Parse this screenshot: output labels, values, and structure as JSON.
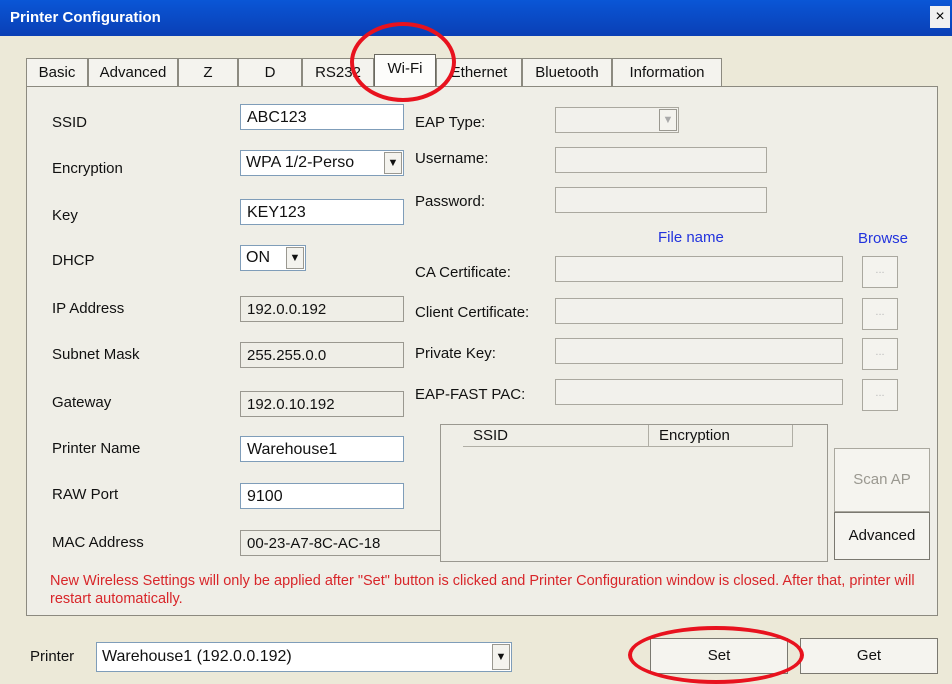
{
  "window": {
    "title": "Printer Configuration",
    "close_glyph": "×"
  },
  "tabs": [
    {
      "label": "Basic"
    },
    {
      "label": "Advanced"
    },
    {
      "label": "Z"
    },
    {
      "label": "D"
    },
    {
      "label": "RS232"
    },
    {
      "label": "Wi-Fi",
      "active": true
    },
    {
      "label": "Ethernet"
    },
    {
      "label": "Bluetooth"
    },
    {
      "label": "Information"
    }
  ],
  "form": {
    "ssid": {
      "label": "SSID",
      "value": "ABC123"
    },
    "encryption": {
      "label": "Encryption",
      "value": "WPA 1/2-Perso"
    },
    "key": {
      "label": "Key",
      "value": "KEY123"
    },
    "dhcp": {
      "label": "DHCP",
      "value": "ON"
    },
    "ip_address": {
      "label": "IP Address",
      "value": "192.0.0.192"
    },
    "subnet_mask": {
      "label": "Subnet Mask",
      "value": "255.255.0.0"
    },
    "gateway": {
      "label": "Gateway",
      "value": "192.0.10.192"
    },
    "printer_name": {
      "label": "Printer Name",
      "value": "Warehouse1"
    },
    "raw_port": {
      "label": "RAW Port",
      "value": "9100"
    },
    "mac_address": {
      "label": "MAC Address",
      "value": "00-23-A7-8C-AC-18"
    }
  },
  "eap": {
    "eap_type_label": "EAP Type:",
    "username_label": "Username:",
    "password_label": "Password:",
    "file_name_header": "File name",
    "browse_header": "Browse",
    "ca_certificate_label": "CA Certificate:",
    "client_certificate_label": "Client Certificate:",
    "private_key_label": "Private Key:",
    "eap_fast_pac_label": "EAP-FAST PAC:",
    "browse_glyph": "..."
  },
  "ap_list": {
    "columns": [
      "SSID",
      "Encryption"
    ]
  },
  "buttons": {
    "scan_ap": "Scan AP",
    "advanced": "Advanced",
    "set": "Set",
    "get": "Get"
  },
  "note": "New Wireless Settings will only be applied after \"Set\" button is clicked and Printer Configuration window is closed. After that, printer will restart automatically.",
  "footer": {
    "printer_label": "Printer",
    "printer_value": "Warehouse1 (192.0.0.192)"
  },
  "colors": {
    "title_bar": "#0a4cc7",
    "note_text": "#d8262a",
    "header_blue": "#2233dd",
    "highlight_circle": "#e8121e"
  },
  "icons": {
    "dropdown": "chevron-down-icon",
    "close": "close-icon"
  }
}
